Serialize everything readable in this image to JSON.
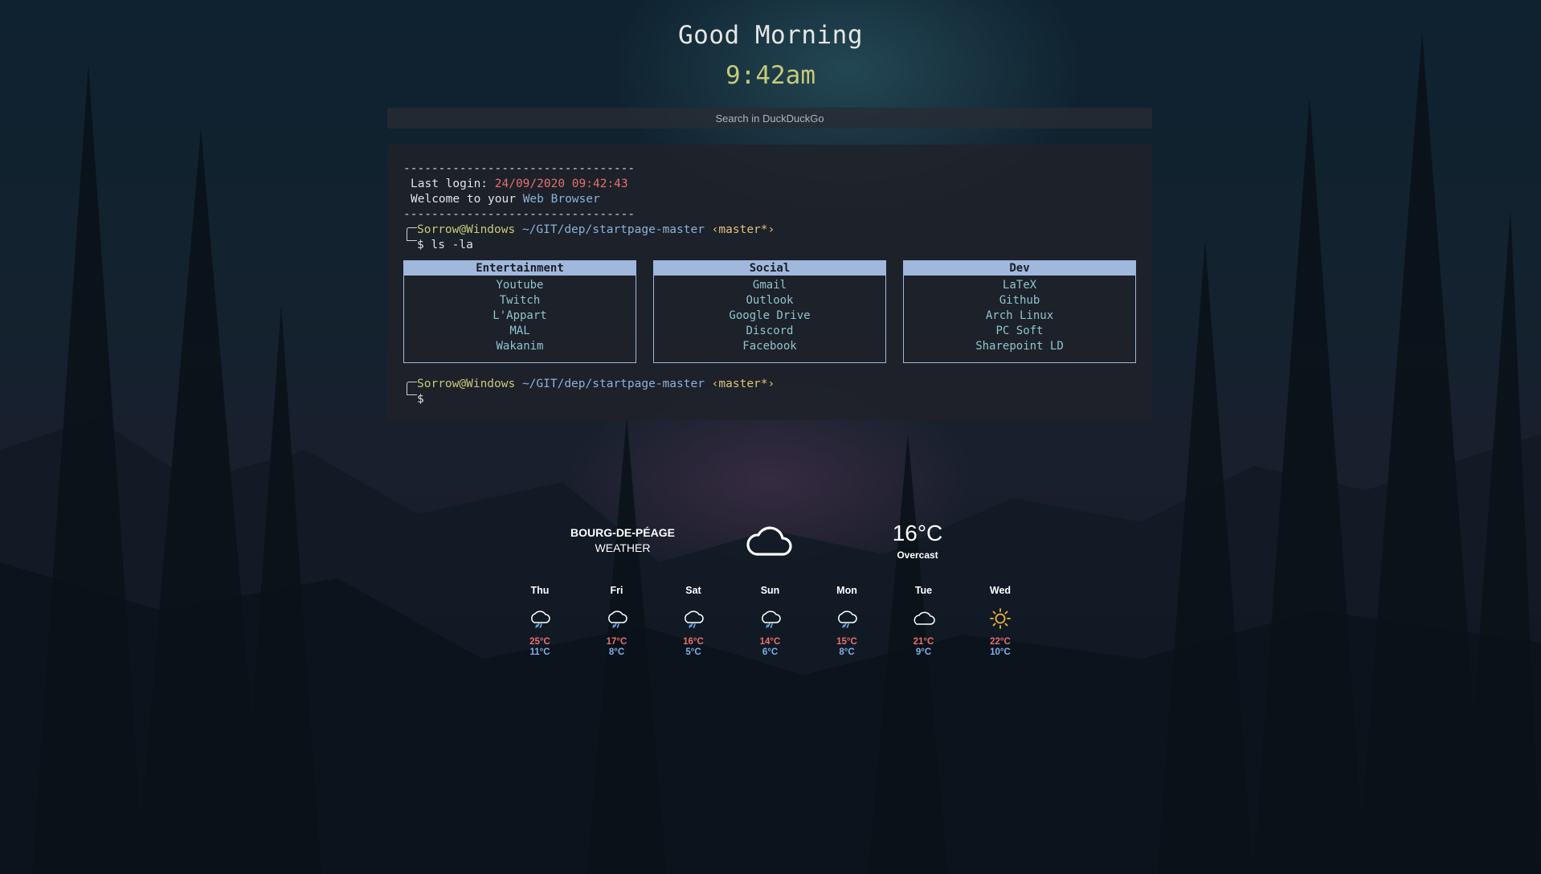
{
  "header": {
    "greeting": "Good Morning",
    "time": "9:42am"
  },
  "search": {
    "placeholder": "Search in DuckDuckGo"
  },
  "terminal": {
    "divider": "---------------------------------",
    "last_login_label": "Last login:",
    "last_login_value": "24/09/2020 09:42:43",
    "welcome_prefix": "Welcome to your",
    "welcome_highlight": "Web Browser",
    "prompt_user": "Sorrow@Windows",
    "prompt_path": "~/GIT/dep/startpage-master",
    "prompt_branch": "‹master*›",
    "command": "$ ls -la",
    "cursor_prompt": "$"
  },
  "bookmarks": [
    {
      "title": "Entertainment",
      "links": [
        "Youtube",
        "Twitch",
        "L'Appart",
        "MAL",
        "Wakanim"
      ]
    },
    {
      "title": "Social",
      "links": [
        "Gmail",
        "Outlook",
        "Google Drive",
        "Discord",
        "Facebook"
      ]
    },
    {
      "title": "Dev",
      "links": [
        "LaTeX",
        "Github",
        "Arch Linux",
        "PC Soft",
        "Sharepoint LD"
      ]
    }
  ],
  "weather": {
    "location": "BOURG-DE-PÉAGE",
    "label": "WEATHER",
    "current_icon": "cloud-icon",
    "temperature": "16°C",
    "condition": "Overcast",
    "forecast": [
      {
        "day": "Thu",
        "icon": "rain-cloud-icon",
        "high": "25°C",
        "low": "11°C"
      },
      {
        "day": "Fri",
        "icon": "rain-cloud-icon",
        "high": "17°C",
        "low": "8°C"
      },
      {
        "day": "Sat",
        "icon": "rain-cloud-icon",
        "high": "16°C",
        "low": "5°C"
      },
      {
        "day": "Sun",
        "icon": "rain-cloud-icon",
        "high": "14°C",
        "low": "6°C"
      },
      {
        "day": "Mon",
        "icon": "rain-cloud-icon",
        "high": "15°C",
        "low": "8°C"
      },
      {
        "day": "Tue",
        "icon": "cloud-icon",
        "high": "21°C",
        "low": "9°C"
      },
      {
        "day": "Wed",
        "icon": "sun-icon",
        "high": "22°C",
        "low": "10°C"
      }
    ]
  },
  "colors": {
    "clock": "#c5c97a",
    "accent_blue": "#9fb8dc",
    "link": "#8ec4cc",
    "warm": "#e8706c",
    "cool": "#7fb0e8",
    "sun": "#f2b632"
  }
}
